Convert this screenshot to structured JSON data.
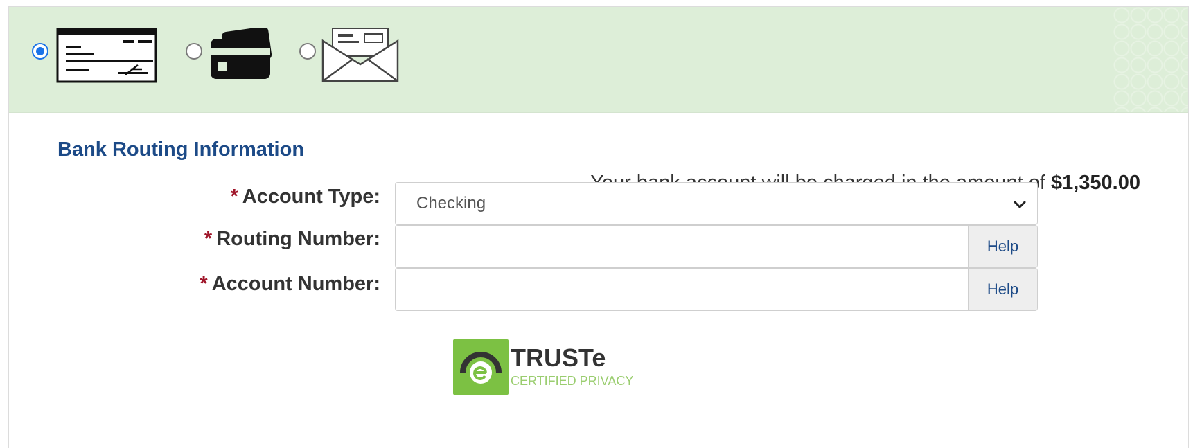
{
  "payment_methods": [
    {
      "name": "check",
      "icon": "check-icon",
      "selected": true
    },
    {
      "name": "card",
      "icon": "credit-card-icon",
      "selected": false
    },
    {
      "name": "mail",
      "icon": "envelope-icon",
      "selected": false
    }
  ],
  "section_title": "Bank Routing Information",
  "charge_note": {
    "text": "Your bank account will be charged in the amount of ",
    "amount": "$1,350.00"
  },
  "form": {
    "required_marker": "*",
    "account_type": {
      "label": "Account Type:",
      "value": "Checking"
    },
    "routing_number": {
      "label": "Routing Number:",
      "value": "",
      "help": "Help"
    },
    "account_number": {
      "label": "Account Number:",
      "value": "",
      "help": "Help"
    }
  },
  "badge": {
    "brand": "TRUSTe",
    "subtitle": "CERTIFIED PRIVACY"
  },
  "colors": {
    "header_bg": "#ddeed8",
    "title": "#1c4a87",
    "required": "#a0162a",
    "radio_selected": "#1a73e8",
    "truste_green": "#7cc143"
  }
}
